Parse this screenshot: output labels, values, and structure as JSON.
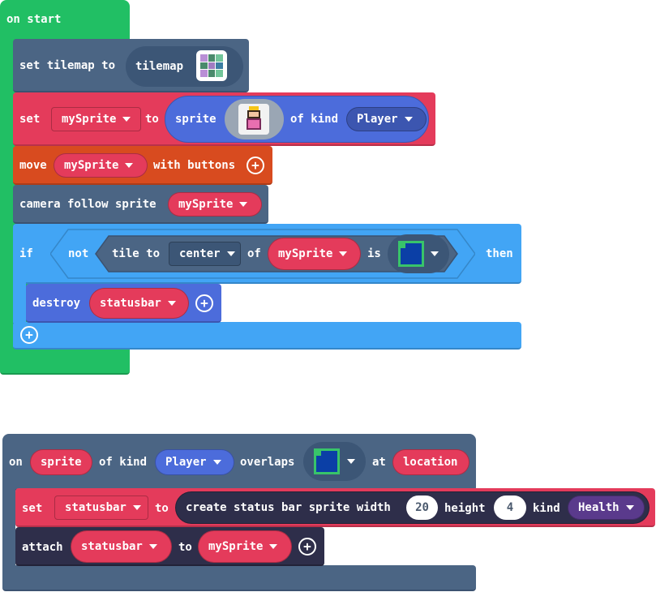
{
  "on_start": {
    "hat_label": "on start",
    "set_tilemap": {
      "prefix": "set tilemap to",
      "value": "tilemap"
    },
    "set_sprite": {
      "set": "set",
      "variable": "mySprite",
      "to": "to",
      "sprite": "sprite",
      "of_kind": "of kind",
      "kind": "Player"
    },
    "move": {
      "label": "move",
      "variable": "mySprite",
      "suffix": "with buttons"
    },
    "camera": {
      "label": "camera follow sprite",
      "variable": "mySprite"
    },
    "if_block": {
      "if": "if",
      "not": "not",
      "tile_to": "tile to",
      "location": "center",
      "of": "of",
      "variable": "mySprite",
      "is": "is",
      "then": "then",
      "destroy": {
        "label": "destroy",
        "variable": "statusbar"
      }
    }
  },
  "overlap_event": {
    "on": "on",
    "sprite": "sprite",
    "of_kind": "of kind",
    "kind": "Player",
    "overlaps": "overlaps",
    "at": "at",
    "location": "location",
    "set_statusbar": {
      "set": "set",
      "variable": "statusbar",
      "to": "to",
      "create": "create status bar sprite width",
      "width": "20",
      "height_label": "height",
      "height": "4",
      "kind_label": "kind",
      "kind": "Health"
    },
    "attach": {
      "label": "attach",
      "variable": "statusbar",
      "to": "to",
      "target": "mySprite"
    }
  },
  "colors": {
    "events": "#21bf64",
    "scene": "#4b6584",
    "variables": "#e43b5b",
    "controller": "#d84b1f",
    "logic": "#42a5f5",
    "sprites": "#4c6cdb",
    "statusbars": "#2e2e4a"
  }
}
